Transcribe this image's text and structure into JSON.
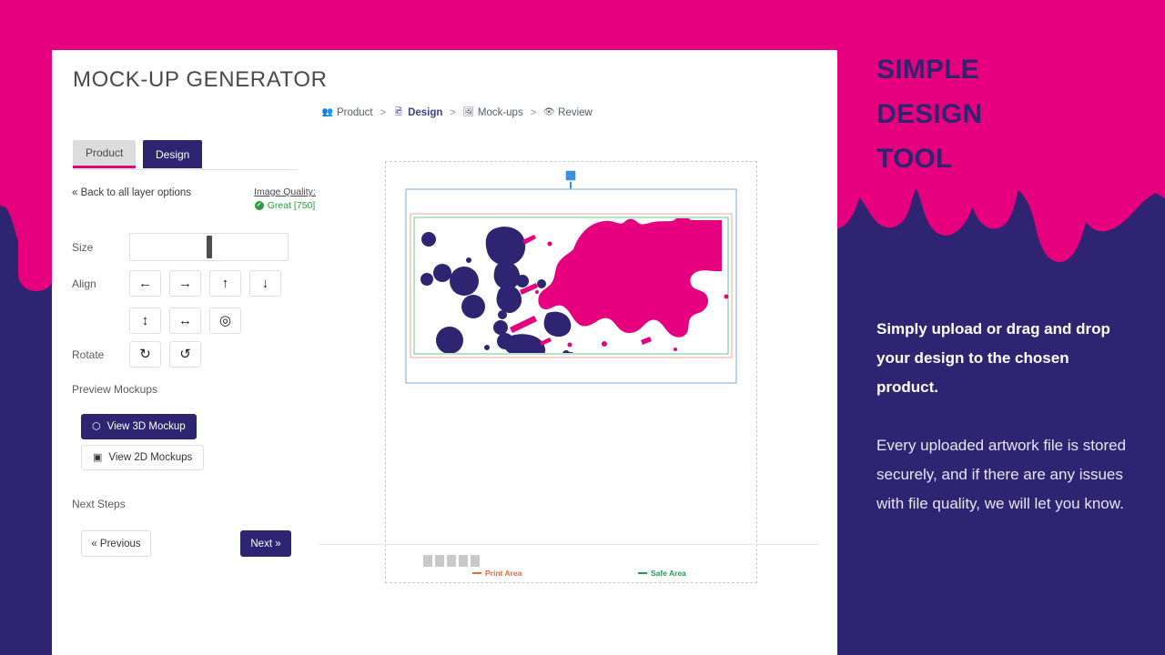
{
  "theme": {
    "pink": "#e6007e",
    "purple": "#2e2472",
    "white": "#ffffff",
    "green": "#2a9d3f",
    "print_area_color": "#f0643c",
    "safe_area_color": "#1f9d55",
    "selection_blue": "#3e8fe0"
  },
  "app": {
    "title": "MOCK-UP GENERATOR"
  },
  "breadcrumb": [
    {
      "label": "Product",
      "icon": "users-icon",
      "glyph": "#",
      "active": false
    },
    {
      "label": "Design",
      "icon": "image-icon",
      "glyph": "#",
      "active": true
    },
    {
      "label": "Mock-ups",
      "icon": "picture-icon",
      "glyph": "#",
      "active": false
    },
    {
      "label": "Review",
      "icon": "eye-icon",
      "glyph": "#",
      "active": false
    }
  ],
  "breadcrumb_separator": ">",
  "tabs": [
    {
      "label": "Product",
      "active": false
    },
    {
      "label": "Design",
      "active": true
    }
  ],
  "layer_panel": {
    "back_link": "« Back to all layer options",
    "quality_label": "Image Quality:",
    "quality_value": "Great [750]",
    "quality_icon": "check-circle-icon",
    "check_glyph": "✓"
  },
  "controls": {
    "size_label": "Size",
    "align_label": "Align",
    "rotate_label": "Rotate",
    "align_buttons_row1": [
      {
        "name": "align-left-button",
        "glyph": "←"
      },
      {
        "name": "align-right-button",
        "glyph": "→"
      },
      {
        "name": "align-top-button",
        "glyph": "↑"
      },
      {
        "name": "align-bottom-button",
        "glyph": "↓"
      }
    ],
    "align_buttons_row2": [
      {
        "name": "stretch-vertical-button",
        "glyph": "↕"
      },
      {
        "name": "stretch-horizontal-button",
        "glyph": "↔"
      },
      {
        "name": "center-target-button",
        "glyph": "◎"
      }
    ],
    "rotate_buttons": [
      {
        "name": "rotate-clockwise-button",
        "glyph": "↻"
      },
      {
        "name": "rotate-counterclockwise-button",
        "glyph": "↺"
      }
    ]
  },
  "preview": {
    "heading": "Preview Mockups",
    "view_3d_label": "View 3D Mockup",
    "view_3d_icon": "cube-icon",
    "view_3d_glyph": "⬡",
    "view_2d_label": "View 2D Mockups",
    "view_2d_icon": "image-icon",
    "view_2d_glyph": "▣"
  },
  "next_steps": {
    "heading": "Next Steps",
    "previous_label": "« Previous",
    "next_label": "Next »"
  },
  "canvas": {
    "legend_print": "Print Area",
    "legend_safe": "Safe Area",
    "thumbnail_count": 5
  },
  "marketing": {
    "title_lines": [
      "SIMPLE",
      "DESIGN",
      "TOOL"
    ],
    "title_text": "SIMPLE DESIGN TOOL",
    "lead": "Simply upload or drag and drop your design to the chosen product.",
    "body": "Every uploaded artwork file is stored securely, and if there are any issues with file quality, we will let you know."
  }
}
